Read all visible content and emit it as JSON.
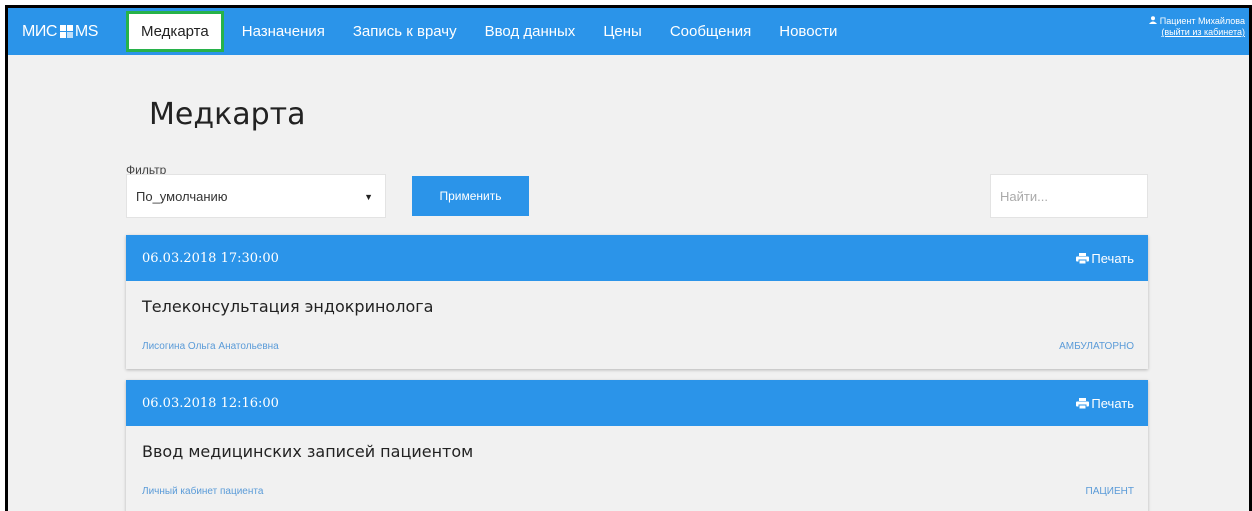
{
  "logo": {
    "text_left": "МИС",
    "text_right": "MS"
  },
  "nav": {
    "items": [
      {
        "label": "Медкарта",
        "active": true
      },
      {
        "label": "Назначения"
      },
      {
        "label": "Запись к врачу"
      },
      {
        "label": "Ввод данных"
      },
      {
        "label": "Цены"
      },
      {
        "label": "Сообщения"
      },
      {
        "label": "Новости"
      }
    ]
  },
  "user": {
    "name": "Пациент Михайлова",
    "logout": "(выйти из кабинета)",
    "icon": "user-icon"
  },
  "page": {
    "title": "Медкарта"
  },
  "filter": {
    "label": "Фильтр",
    "selected": "По_умолчанию"
  },
  "apply_button": "Применить",
  "search": {
    "placeholder": "Найти..."
  },
  "records": [
    {
      "datetime": "06.03.2018 17:30:00",
      "print_label": "Печать",
      "title": "Телеконсультация эндокринолога",
      "author": "Лисогина Ольга Анатольевна",
      "type": "АМБУЛАТОРНО"
    },
    {
      "datetime": "06.03.2018 12:16:00",
      "print_label": "Печать",
      "title": "Ввод медицинских записей пациентом",
      "author": "Личный кабинет пациента",
      "type": "ПАЦИЕНТ"
    }
  ],
  "colors": {
    "accent": "#2b94e9",
    "active_border": "#27b24a",
    "background": "#f1f1f1"
  }
}
